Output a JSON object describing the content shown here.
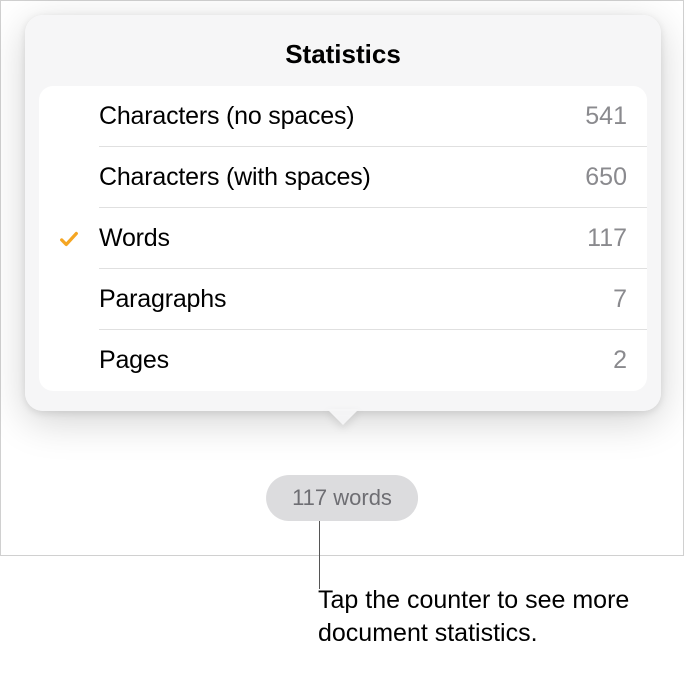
{
  "popover": {
    "title": "Statistics",
    "stats": [
      {
        "label": "Characters (no spaces)",
        "value": "541",
        "selected": false
      },
      {
        "label": "Characters (with spaces)",
        "value": "650",
        "selected": false
      },
      {
        "label": "Words",
        "value": "117",
        "selected": true
      },
      {
        "label": "Paragraphs",
        "value": "7",
        "selected": false
      },
      {
        "label": "Pages",
        "value": "2",
        "selected": false
      }
    ]
  },
  "counter": {
    "label": "117 words"
  },
  "callout": {
    "text": "Tap the counter to see more document statistics."
  },
  "colors": {
    "accent": "#f5a623"
  }
}
